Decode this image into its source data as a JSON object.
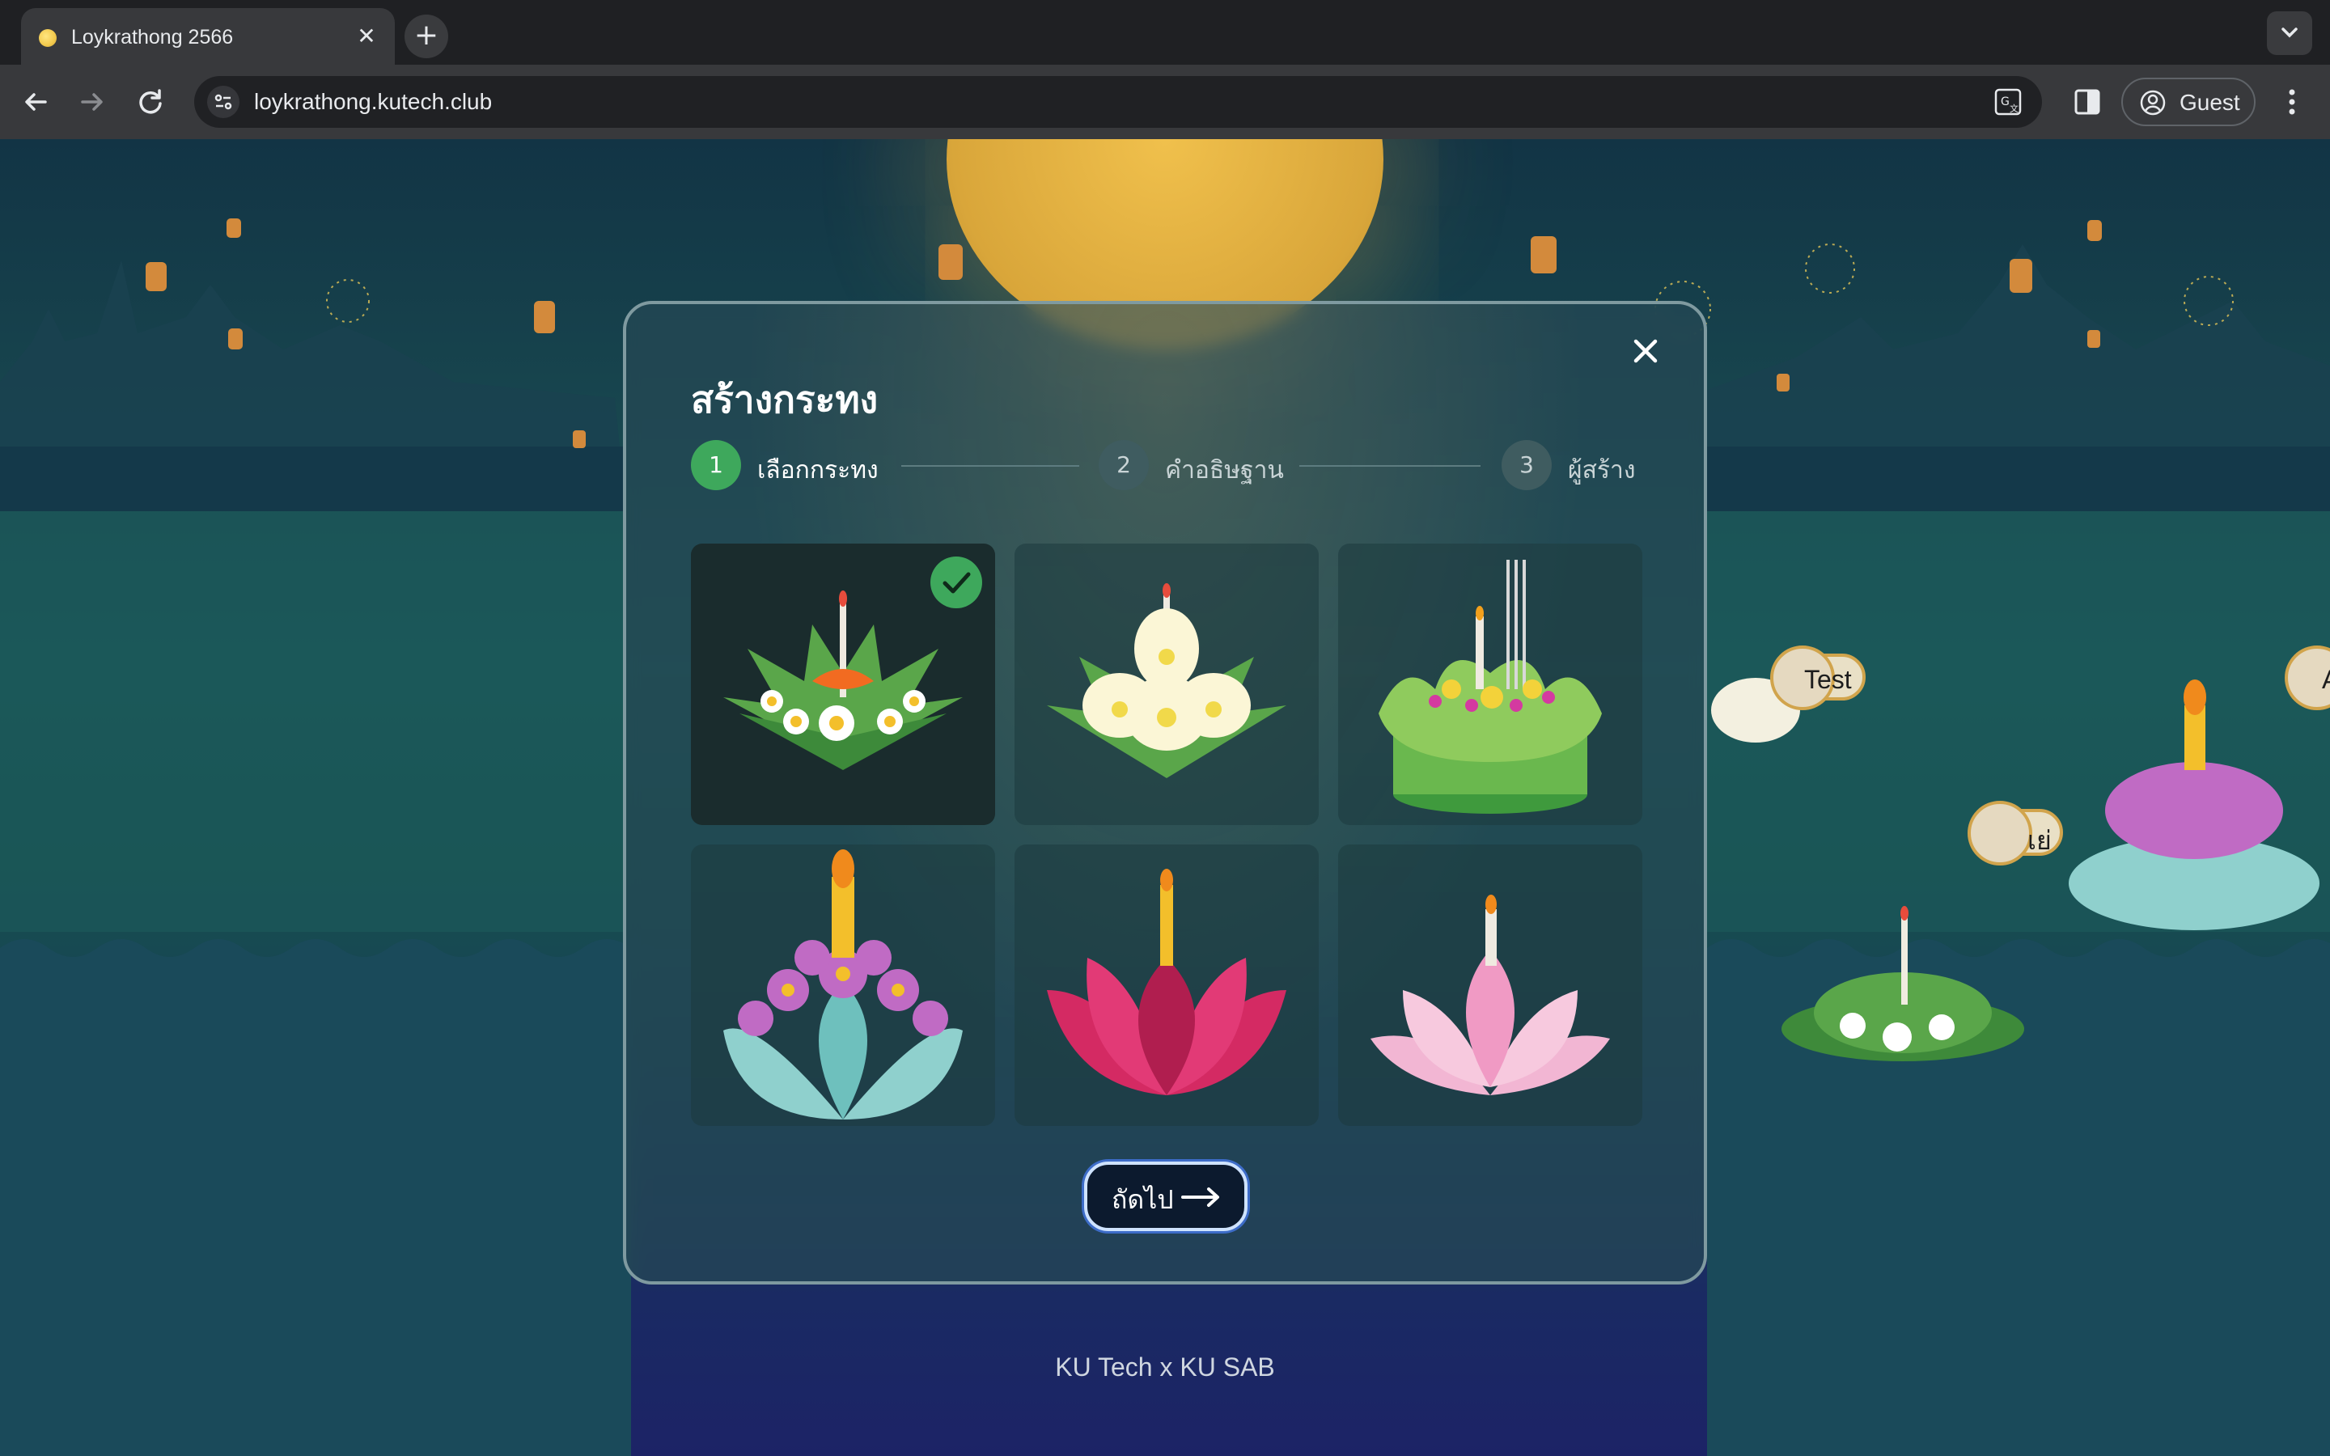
{
  "browser": {
    "tab_title": "Loykrathong 2566",
    "url": "loykrathong.kutech.club",
    "profile_label": "Guest",
    "icons": [
      "moon-favicon-icon",
      "close-icon",
      "plus-icon",
      "chevron-down-icon",
      "back-arrow-icon",
      "forward-arrow-icon",
      "reload-icon",
      "site-info-icon",
      "translate-icon",
      "side-panel-icon",
      "profile-icon",
      "more-vert-icon"
    ]
  },
  "modal": {
    "title": "สร้างกระทง",
    "steps": [
      {
        "number": "1",
        "label": "เลือกกระทง",
        "state": "active"
      },
      {
        "number": "2",
        "label": "คำอธิษฐาน",
        "state": "inactive"
      },
      {
        "number": "3",
        "label": "ผู้สร้าง",
        "state": "inactive"
      }
    ],
    "krathong_options": [
      {
        "id": "banana-leaf-flowers",
        "selected": true
      },
      {
        "id": "white-frangipani",
        "selected": false
      },
      {
        "id": "green-incense",
        "selected": false
      },
      {
        "id": "blue-lotus-purple",
        "selected": false
      },
      {
        "id": "red-lotus",
        "selected": false
      },
      {
        "id": "pink-lotus",
        "selected": false
      }
    ],
    "next_label": "ถัดไป"
  },
  "background_floats": [
    {
      "name": "Test"
    },
    {
      "name": "เย่"
    },
    {
      "name": "A"
    }
  ],
  "footer": "KU Tech x KU SAB",
  "colors": {
    "accent_green": "#3ea85c",
    "step_inactive": "#3f5c60",
    "button_bg": "#0c1a2e",
    "button_border": "#cfe3ff"
  }
}
